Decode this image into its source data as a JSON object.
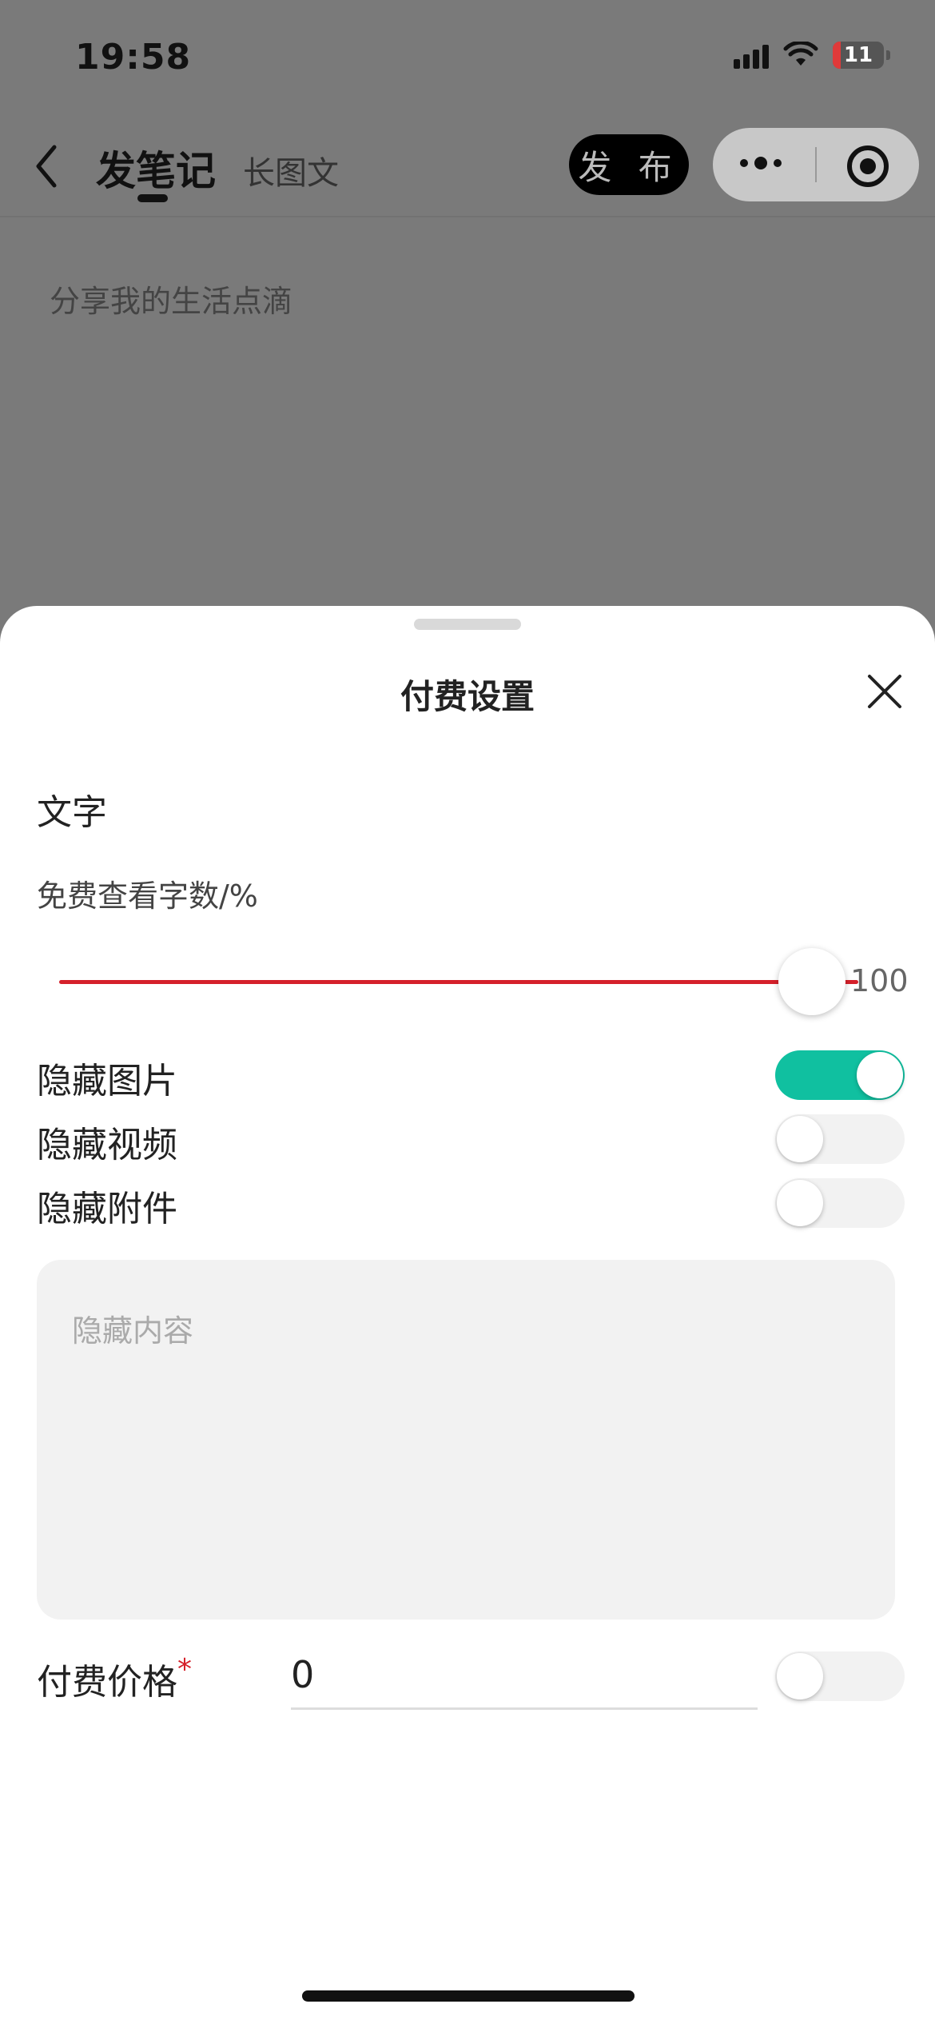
{
  "status_bar": {
    "time": "19:58",
    "battery_level": "11"
  },
  "header": {
    "tab_active": "发笔记",
    "tab_inactive": "长图文",
    "publish_label": "发 布"
  },
  "background": {
    "placeholder": "分享我的生活点滴"
  },
  "sheet": {
    "title": "付费设置",
    "section_label": "文字",
    "slider": {
      "caption": "免费查看字数/%",
      "value": "100",
      "level_percent": 100,
      "accent": "#d5202a"
    },
    "toggles": [
      {
        "label": "隐藏图片",
        "on": true
      },
      {
        "label": "隐藏视频",
        "on": false
      },
      {
        "label": "隐藏附件",
        "on": false
      }
    ],
    "hidden_content_placeholder": "隐藏内容",
    "price": {
      "label": "付费价格",
      "required_mark": "*",
      "value": "0",
      "toggle_on": false
    }
  },
  "colors": {
    "toggle_on": "#10c0a0",
    "required": "#d5202a"
  }
}
